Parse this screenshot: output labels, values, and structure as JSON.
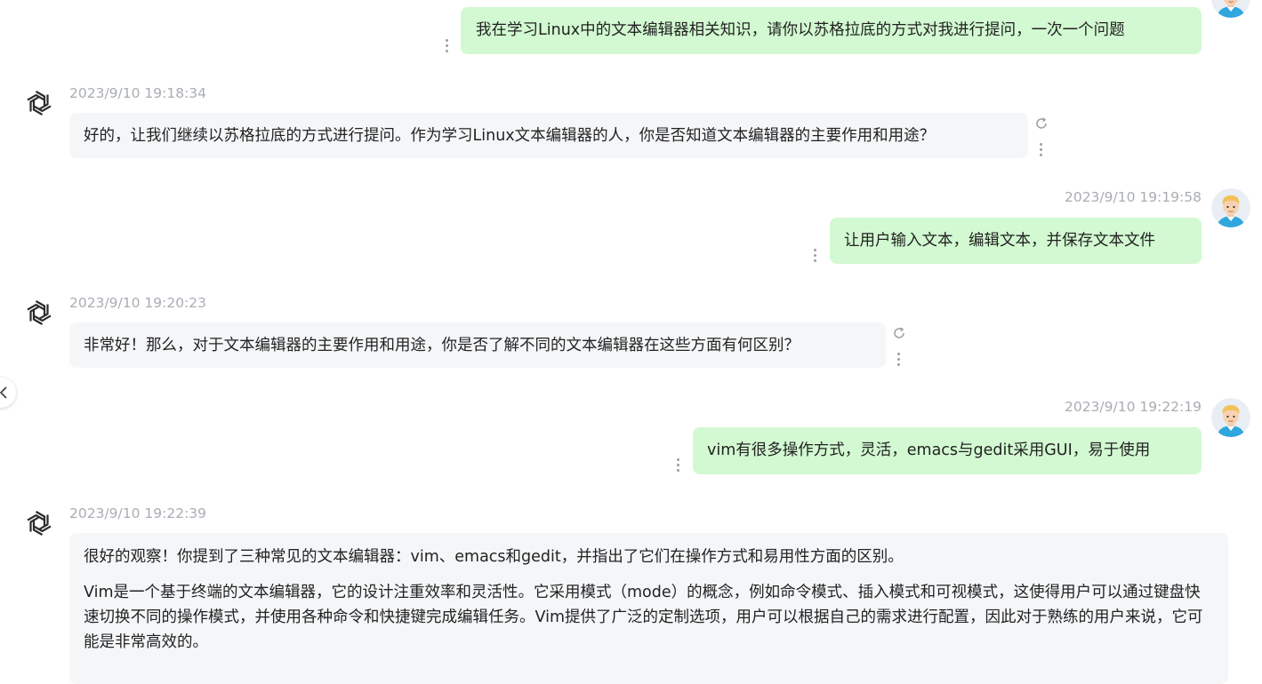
{
  "messages": [
    {
      "role": "user",
      "text": "我在学习Linux中的文本编辑器相关知识，请你以苏格拉底的方式对我进行提问，一次一个问题"
    },
    {
      "role": "assistant",
      "timestamp": "2023/9/10 19:18:34",
      "text": "好的，让我们继续以苏格拉底的方式进行提问。作为学习Linux文本编辑器的人，你是否知道文本编辑器的主要作用和用途？"
    },
    {
      "role": "user",
      "timestamp": "2023/9/10 19:19:58",
      "text": "让用户输入文本，编辑文本，并保存文本文件"
    },
    {
      "role": "assistant",
      "timestamp": "2023/9/10 19:20:23",
      "text": "非常好！那么，对于文本编辑器的主要作用和用途，你是否了解不同的文本编辑器在这些方面有何区别？"
    },
    {
      "role": "user",
      "timestamp": "2023/9/10 19:22:19",
      "text": "vim有很多操作方式，灵活，emacs与gedit采用GUI，易于使用"
    },
    {
      "role": "assistant",
      "timestamp": "2023/9/10 19:22:39",
      "paragraphs": [
        "很好的观察！你提到了三种常见的文本编辑器：vim、emacs和gedit，并指出了它们在操作方式和易用性方面的区别。",
        "Vim是一个基于终端的文本编辑器，它的设计注重效率和灵活性。它采用模式（mode）的概念，例如命令模式、插入模式和可视模式，这使得用户可以通过键盘快速切换不同的操作模式，并使用各种命令和快捷键完成编辑任务。Vim提供了广泛的定制选项，用户可以根据自己的需求进行配置，因此对于熟练的用户来说，它可能是非常高效的。"
      ]
    }
  ],
  "icons": {
    "assistant_avatar": "openai-logo-icon",
    "user_avatar": "user-avatar-icon",
    "more": "more-vertical-icon",
    "regenerate": "refresh-icon",
    "collapse": "chevron-left-icon"
  },
  "colors": {
    "user_bubble": "#d2f9d1",
    "bot_bubble": "#f4f6f8",
    "timestamp": "#a9adb3"
  }
}
